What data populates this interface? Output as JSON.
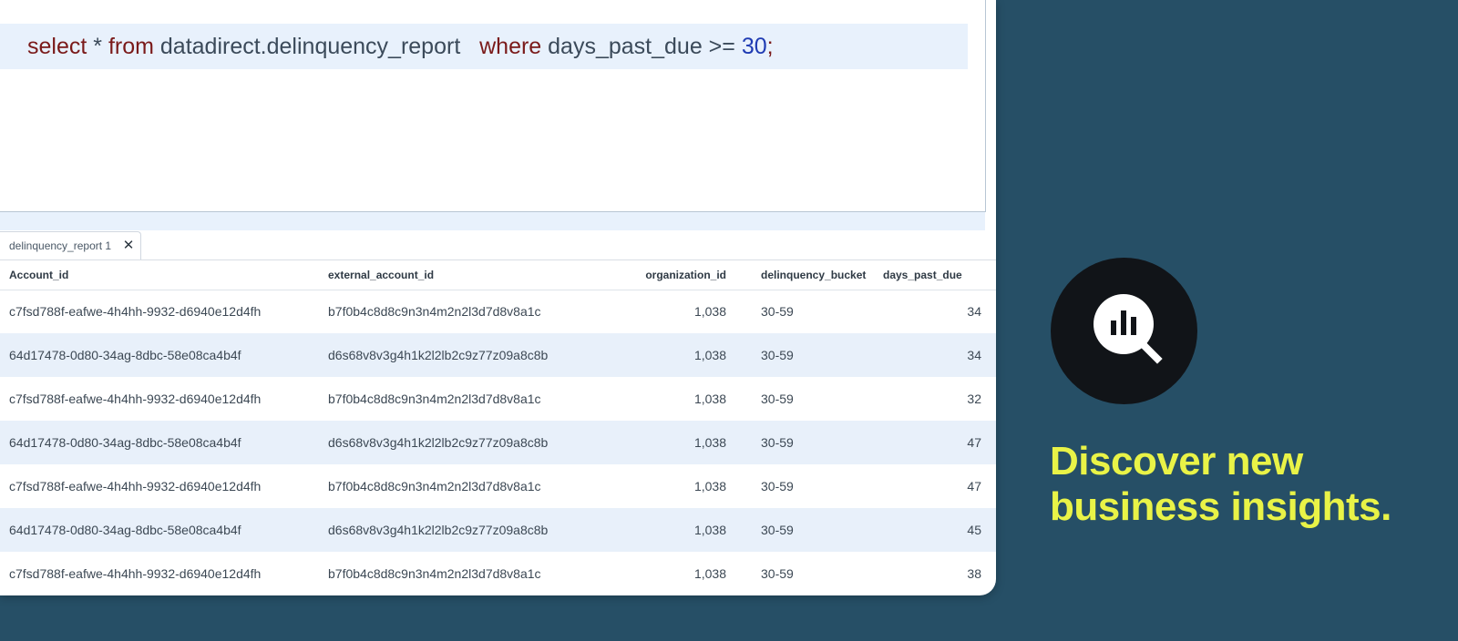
{
  "editor": {
    "tokens": [
      {
        "text": "select",
        "kind": "kw"
      },
      {
        "text": " * ",
        "kind": "plain"
      },
      {
        "text": "from",
        "kind": "kw"
      },
      {
        "text": " datadirect.delinquency_report   ",
        "kind": "plain"
      },
      {
        "text": "where",
        "kind": "kw"
      },
      {
        "text": " days_past_due >= ",
        "kind": "plain"
      },
      {
        "text": "30",
        "kind": "num"
      },
      {
        "text": ";",
        "kind": "kw"
      }
    ]
  },
  "results": {
    "tab_label": "delinquency_report 1",
    "close_glyph": "✕",
    "columns": [
      "Account_id",
      "external_account_id",
      "organization_id",
      "delinquency_bucket",
      "days_past_due"
    ],
    "rows": [
      [
        "c7fsd788f-eafwe-4h4hh-9932-d6940e12d4fh",
        "b7f0b4c8d8c9n3n4m2n2l3d7d8v8a1c",
        "1,038",
        "30-59",
        "34"
      ],
      [
        "64d17478-0d80-34ag-8dbc-58e08ca4b4f",
        "d6s68v8v3g4h1k2l2lb2c9z77z09a8c8b",
        "1,038",
        "30-59",
        "34"
      ],
      [
        "c7fsd788f-eafwe-4h4hh-9932-d6940e12d4fh",
        "b7f0b4c8d8c9n3n4m2n2l3d7d8v8a1c",
        "1,038",
        "30-59",
        "32"
      ],
      [
        "64d17478-0d80-34ag-8dbc-58e08ca4b4f",
        "d6s68v8v3g4h1k2l2lb2c9z77z09a8c8b",
        "1,038",
        "30-59",
        "47"
      ],
      [
        "c7fsd788f-eafwe-4h4hh-9932-d6940e12d4fh",
        "b7f0b4c8d8c9n3n4m2n2l3d7d8v8a1c",
        "1,038",
        "30-59",
        "47"
      ],
      [
        "64d17478-0d80-34ag-8dbc-58e08ca4b4f",
        "d6s68v8v3g4h1k2l2lb2c9z77z09a8c8b",
        "1,038",
        "30-59",
        "45"
      ],
      [
        "c7fsd788f-eafwe-4h4hh-9932-d6940e12d4fh",
        "b7f0b4c8d8c9n3n4m2n2l3d7d8v8a1c",
        "1,038",
        "30-59",
        "38"
      ]
    ]
  },
  "promo": {
    "icon": "bar-chart-magnifier-icon",
    "line1": "Discover new",
    "line2": "business insights."
  },
  "colors": {
    "background": "#264f66",
    "accent_text": "#e9f347",
    "keyword": "#7a1a1a",
    "number": "#1f3bb3"
  }
}
